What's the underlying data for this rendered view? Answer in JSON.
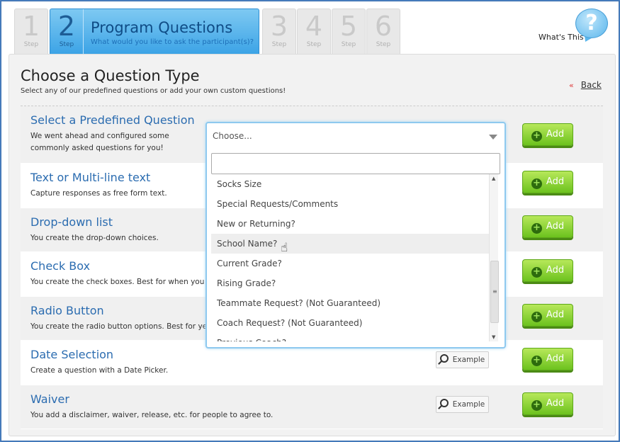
{
  "steps": {
    "tabs": [
      {
        "num": "1",
        "label": "Step"
      },
      {
        "num": "2",
        "label": "Step"
      },
      {
        "num": "3",
        "label": "Step"
      },
      {
        "num": "4",
        "label": "Step"
      },
      {
        "num": "5",
        "label": "Step"
      },
      {
        "num": "6",
        "label": "Step"
      }
    ],
    "active_title": "Program Questions",
    "active_subtitle": "What would you like to ask the participant(s)?"
  },
  "help": {
    "label": "What's This",
    "icon": "question-mark-bubble-icon",
    "glyph": "?"
  },
  "page": {
    "heading": "Choose a Question Type",
    "subheading": "Select any of our predefined questions or add your own custom questions!",
    "back_label": "Back",
    "back_arrow": "«"
  },
  "questions": [
    {
      "title": "Select a Predefined Question",
      "desc": "We went ahead and configured some commonly asked questions for you!",
      "add": "Add"
    },
    {
      "title": "Text or Multi-line text",
      "desc": "Capture responses as free form text.",
      "add": "Add"
    },
    {
      "title": "Drop-down list",
      "desc": "You create the drop-down choices.",
      "add": "Add"
    },
    {
      "title": "Check Box",
      "desc": "You create the check boxes. Best for when you wa",
      "add": "Add"
    },
    {
      "title": "Radio Button",
      "desc": "You create the radio button options. Best for yes/r",
      "add": "Add"
    },
    {
      "title": "Date Selection",
      "desc": "Create a question with a Date Picker.",
      "add": "Add",
      "example": "Example"
    },
    {
      "title": "Waiver",
      "desc": "You add a disclaimer, waiver, release, etc. for people to agree to.",
      "add": "Add",
      "example": "Example"
    }
  ],
  "dropdown": {
    "selected": "Choose...",
    "search_value": "",
    "options": [
      "Socks Size",
      "Special Requests/Comments",
      "New or Returning?",
      "School Name?",
      "Current Grade?",
      "Rising Grade?",
      "Teammate Request? (Not Guaranteed)",
      "Coach Request? (Not Guaranteed)",
      "Previous Coach?"
    ],
    "highlighted": "School Name?"
  },
  "colors": {
    "accent": "#3ba3e6",
    "add_button": "#6cc21e",
    "link": "#2b6cb0"
  }
}
